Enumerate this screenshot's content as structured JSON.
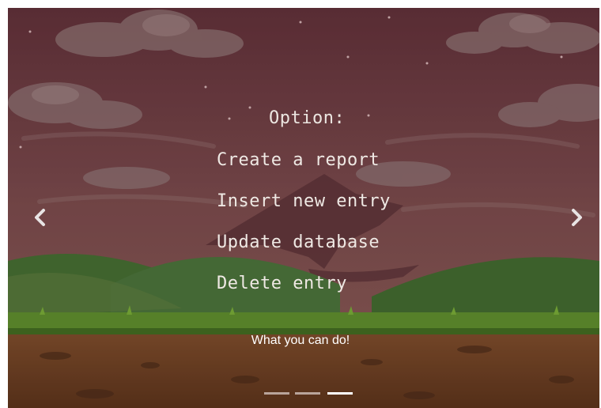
{
  "carousel": {
    "menu": {
      "title": "Option:",
      "items": [
        {
          "label": "Create a report"
        },
        {
          "label": "Insert new entry"
        },
        {
          "label": "Update database"
        },
        {
          "label": "Delete entry"
        }
      ]
    },
    "caption": "What you can do!",
    "prev_icon": "chevron-left-icon",
    "next_icon": "chevron-right-icon",
    "slides_total": 3,
    "active_slide": 3,
    "colors": {
      "sky": "#6d3d45",
      "hills": "#3f6a2e",
      "grass": "#5a8d2a",
      "dirt": "#7b4a28",
      "text": "#efe9e4"
    }
  }
}
